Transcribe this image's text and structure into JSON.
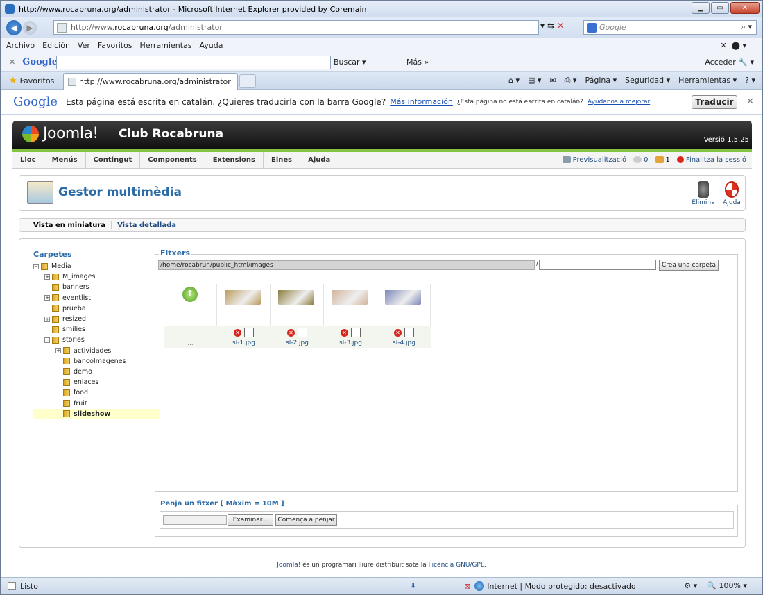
{
  "window": {
    "title": "http://www.rocabruna.org/administrator - Microsoft Internet Explorer provided by Coremain"
  },
  "address": {
    "prefix": "http://www.",
    "domain": "rocabruna.org",
    "path": "/administrator"
  },
  "search": {
    "placeholder": "Google"
  },
  "menubar": {
    "items": [
      "Archivo",
      "Edición",
      "Ver",
      "Favoritos",
      "Herramientas",
      "Ayuda"
    ]
  },
  "google_toolbar": {
    "logo": "Google",
    "buscar": "Buscar",
    "mas": "Más",
    "acceder": "Acceder"
  },
  "tabs": {
    "favoritos": "Favoritos",
    "active_tab": "http://www.rocabruna.org/administrator"
  },
  "commandbar": {
    "items": [
      "Página",
      "Seguridad",
      "Herramientas"
    ]
  },
  "translate": {
    "logo": "Google",
    "message": "Esta página está escrita en catalán. ¿Quieres traducirla con la barra Google?",
    "more_info": "Más información",
    "not_catalan": "¿Esta página no está escrita en catalán?",
    "help": "Ayúdanos a mejorar",
    "button": "Traducir"
  },
  "joomla": {
    "logo": "Joomla!",
    "site": "Club Rocabruna",
    "version": "Versió 1.5.25",
    "menu": [
      "Lloc",
      "Menús",
      "Contingut",
      "Components",
      "Extensions",
      "Eines",
      "Ajuda"
    ],
    "preview": "Previsualització",
    "messages": "0",
    "users": "1",
    "logout": "Finalitza la sessió",
    "page_title": "Gestor multimèdia",
    "delete": "Elimina",
    "help": "Ajuda",
    "views": [
      "Vista en miniatura",
      "Vista detallada"
    ]
  },
  "tree": {
    "header": "Carpetes",
    "root": "Media",
    "folders": [
      "M_images",
      "banners",
      "eventlist",
      "prueba",
      "resized",
      "smilies",
      "stories"
    ],
    "subfolders": [
      "actividades",
      "bancoImagenes",
      "demo",
      "enlaces",
      "food",
      "fruit",
      "slideshow"
    ],
    "selected": "slideshow"
  },
  "files": {
    "legend": "Fitxers",
    "path": "/home/rocabrun/public_html/images",
    "separator": "/",
    "create_folder": "Crea una carpeta",
    "up_label": "...",
    "items": [
      {
        "name": "sl-1.jpg",
        "color": "#b89a5a"
      },
      {
        "name": "sl-2.jpg",
        "color": "#8a7a3a"
      },
      {
        "name": "sl-3.jpg",
        "color": "#d2b39a"
      },
      {
        "name": "sl-4.jpg",
        "color": "#7a86b8"
      }
    ]
  },
  "upload": {
    "legend": "Penja un fitxer [ Màxim = 10M ]",
    "browse": "Examinar...",
    "start": "Comença a penjar"
  },
  "footer": {
    "link": "Joomla!",
    "text": "és un programari lliure distribuït sota la",
    "license": "llicència GNU/GPL",
    "end": "."
  },
  "status": {
    "state": "Listo",
    "zone": "Internet | Modo protegido: desactivado",
    "zoom": "100%"
  }
}
